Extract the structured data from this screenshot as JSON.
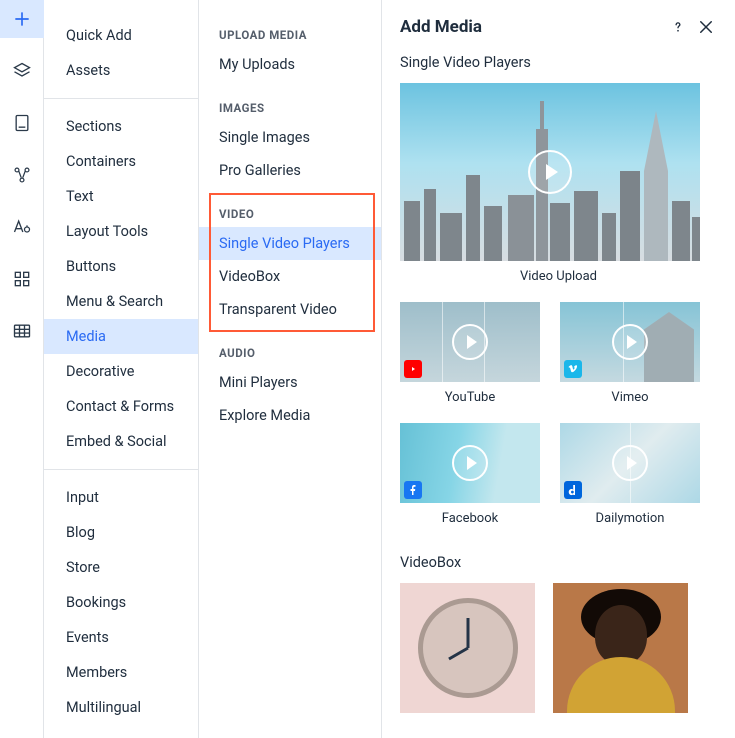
{
  "rail": {
    "icons": [
      "plus-icon",
      "layers-icon",
      "page-icon",
      "nodes-icon",
      "text-style-icon",
      "grid-icon",
      "table-icon"
    ]
  },
  "primary": {
    "top": [
      {
        "label": "Quick Add",
        "key": "quick-add"
      },
      {
        "label": "Assets",
        "key": "assets"
      }
    ],
    "mid": [
      {
        "label": "Sections",
        "key": "sections"
      },
      {
        "label": "Containers",
        "key": "containers"
      },
      {
        "label": "Text",
        "key": "text"
      },
      {
        "label": "Layout Tools",
        "key": "layout-tools"
      },
      {
        "label": "Buttons",
        "key": "buttons"
      },
      {
        "label": "Menu & Search",
        "key": "menu-search"
      },
      {
        "label": "Media",
        "key": "media",
        "active": true
      },
      {
        "label": "Decorative",
        "key": "decorative"
      },
      {
        "label": "Contact & Forms",
        "key": "contact-forms"
      },
      {
        "label": "Embed & Social",
        "key": "embed-social"
      }
    ],
    "bottom": [
      {
        "label": "Input",
        "key": "input"
      },
      {
        "label": "Blog",
        "key": "blog"
      },
      {
        "label": "Store",
        "key": "store"
      },
      {
        "label": "Bookings",
        "key": "bookings"
      },
      {
        "label": "Events",
        "key": "events"
      },
      {
        "label": "Members",
        "key": "members"
      },
      {
        "label": "Multilingual",
        "key": "multilingual"
      }
    ]
  },
  "secondary": {
    "groups": [
      {
        "title": "UPLOAD MEDIA",
        "items": [
          {
            "label": "My Uploads"
          }
        ]
      },
      {
        "title": "IMAGES",
        "items": [
          {
            "label": "Single Images"
          },
          {
            "label": "Pro Galleries"
          }
        ]
      },
      {
        "title": "VIDEO",
        "highlight": true,
        "items": [
          {
            "label": "Single Video Players",
            "active": true
          },
          {
            "label": "VideoBox"
          },
          {
            "label": "Transparent Video"
          }
        ]
      },
      {
        "title": "AUDIO",
        "items": [
          {
            "label": "Mini Players"
          },
          {
            "label": "Explore Media"
          }
        ]
      }
    ]
  },
  "main": {
    "title": "Add Media",
    "section1": "Single Video Players",
    "hero_label": "Video Upload",
    "providers": [
      {
        "label": "YouTube",
        "badge": "youtube"
      },
      {
        "label": "Vimeo",
        "badge": "vimeo"
      },
      {
        "label": "Facebook",
        "badge": "facebook"
      },
      {
        "label": "Dailymotion",
        "badge": "dailymotion"
      }
    ],
    "section2": "VideoBox"
  }
}
